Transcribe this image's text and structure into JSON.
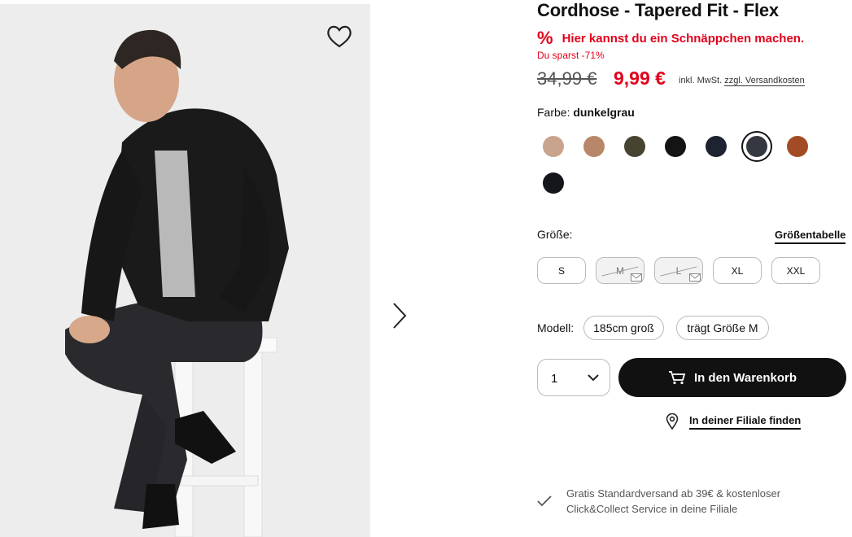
{
  "product": {
    "title": "Cordhose - Tapered Fit - Flex",
    "deal_icon": "%",
    "deal_text": "Hier kannst du ein Schnäppchen machen.",
    "savings": "Du sparst -71%",
    "old_price": "34,99 €",
    "new_price": "9,99 €",
    "vat_text": "inkl. MwSt.",
    "shipping_link": "zzgl. Versandkosten",
    "accent_color": "#e3001b"
  },
  "color": {
    "label": "Farbe:",
    "selected": "dunkelgrau",
    "swatches": [
      "#c9a48c",
      "#b88669",
      "#474331",
      "#141414",
      "#1d2330",
      "#353840",
      "#a24b24",
      "#15161c"
    ],
    "selected_index": 5
  },
  "size": {
    "label": "Größe:",
    "table_link": "Größentabelle",
    "options": [
      {
        "label": "S",
        "available": true
      },
      {
        "label": "M",
        "available": false
      },
      {
        "label": "L",
        "available": false
      },
      {
        "label": "XL",
        "available": true
      },
      {
        "label": "XXL",
        "available": true
      }
    ]
  },
  "model": {
    "label": "Modell:",
    "height": "185cm groß",
    "wears": "trägt Größe M"
  },
  "cart": {
    "quantity": "1",
    "button_label": "In den Warenkorb"
  },
  "store_link": "In deiner Filiale finden",
  "shipping_info": {
    "line1": "Gratis Standardversand ab 39€ & kostenloser",
    "line2": "Click&Collect Service in deine Filiale"
  },
  "icons": [
    "heart-icon",
    "chevron-right-icon",
    "percent-icon",
    "chevron-down-icon",
    "cart-icon",
    "location-pin-icon",
    "check-icon",
    "mail-icon"
  ]
}
